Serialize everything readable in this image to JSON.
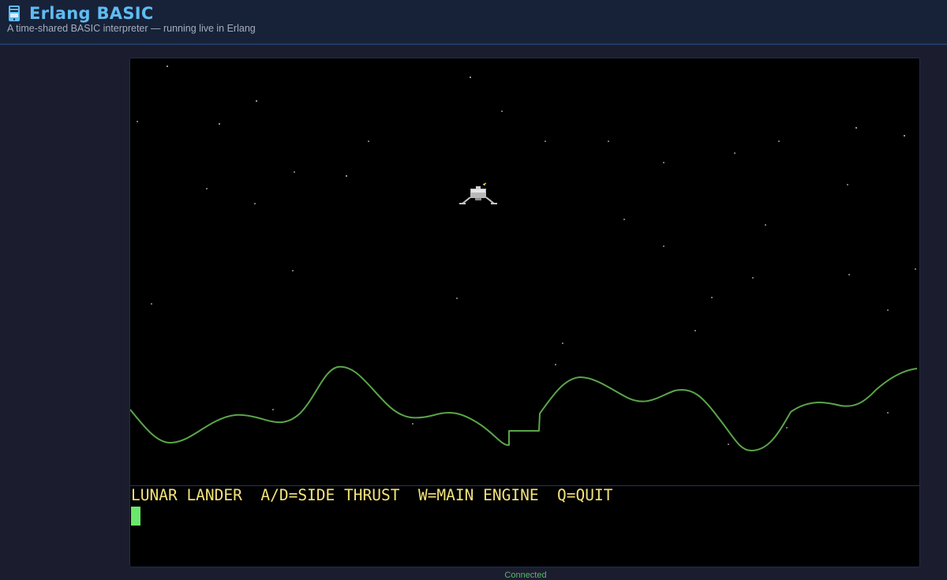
{
  "header": {
    "title": "Erlang BASIC",
    "subtitle": "A time-shared BASIC interpreter — running live in Erlang",
    "icon": "computer-tower-icon",
    "accent_color": "#5fbcf2"
  },
  "terminal": {
    "output_line": "LUNAR LANDER  A/D=SIDE THRUST  W=MAIN ENGINE  Q=QUIT",
    "text_color": "#f3e37a",
    "cursor_color": "#6be86b"
  },
  "game": {
    "terrain_color": "#5aa648",
    "lander": "lunar-lander-icon"
  },
  "status": {
    "text": "Connected",
    "color": "#58b868"
  }
}
